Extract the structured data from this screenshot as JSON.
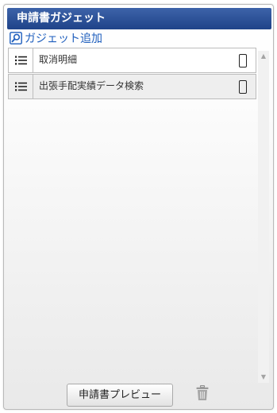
{
  "header": {
    "title": "申請書ガジェット"
  },
  "toolbar": {
    "add_gadget_label": "ガジェット追加"
  },
  "gadgets": [
    {
      "name": "取消明細",
      "device_icon": "smartphone-icon"
    },
    {
      "name": "出張手配実績データ検索",
      "device_icon": "smartphone-icon"
    }
  ],
  "footer": {
    "preview_label": "申請書プレビュー",
    "delete_icon": "trash-icon"
  },
  "colors": {
    "titlebar": "#2a4f97",
    "link": "#1e5ebd",
    "row_alt": "#eeeeee"
  }
}
